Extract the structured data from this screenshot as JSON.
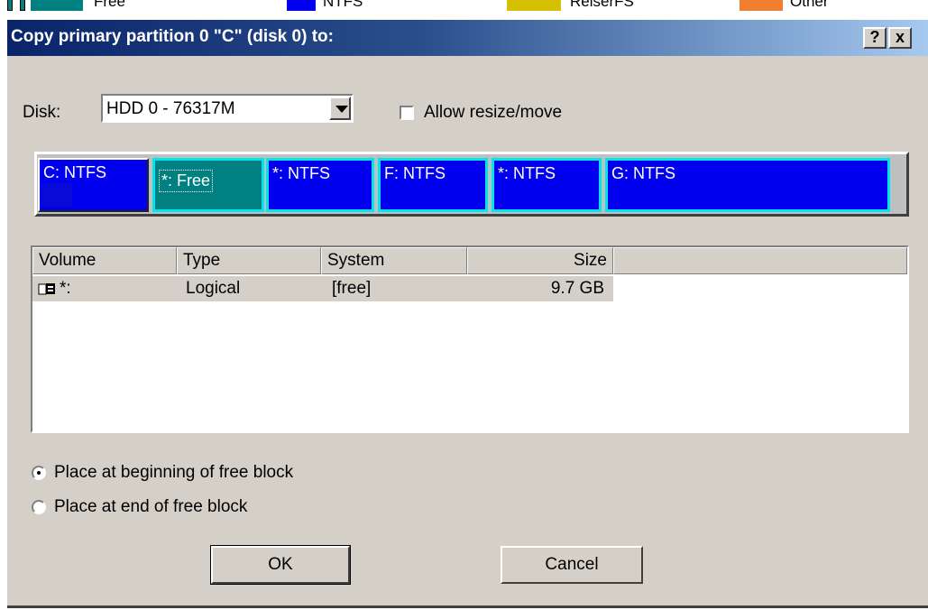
{
  "legend": [
    {
      "label": "Free",
      "color": "#008080"
    },
    {
      "label": "NTFS",
      "color": "#0000ee"
    },
    {
      "label": "ReiserFS",
      "color": "#d4c000"
    },
    {
      "label": "Other",
      "color": "#f08030"
    }
  ],
  "dialog": {
    "title": "Copy primary partition 0  \"C\" (disk 0)  to:",
    "help_label": "?",
    "close_label": "x"
  },
  "disk": {
    "label": "Disk:",
    "value": "HDD 0 - 76317M",
    "allow_resize_label": "Allow resize/move",
    "allow_resize_checked": false
  },
  "partitions": [
    {
      "label": "C: NTFS",
      "type": "NTFS"
    },
    {
      "label": "*: Free",
      "type": "Free",
      "selected": true
    },
    {
      "label": "*: NTFS",
      "type": "NTFS"
    },
    {
      "label": "F: NTFS",
      "type": "NTFS"
    },
    {
      "label": "*: NTFS",
      "type": "NTFS"
    },
    {
      "label": "G: NTFS",
      "type": "NTFS"
    }
  ],
  "table": {
    "columns": [
      "Volume",
      "Type",
      "System",
      "Size"
    ],
    "rows": [
      {
        "volume": "*:",
        "type": "Logical",
        "system": "[free]",
        "size": "9.7 GB"
      }
    ]
  },
  "placement": {
    "option_beginning": "Place at beginning of free block",
    "option_end": "Place at end of free block",
    "selected": "beginning"
  },
  "buttons": {
    "ok": "OK",
    "cancel": "Cancel"
  }
}
